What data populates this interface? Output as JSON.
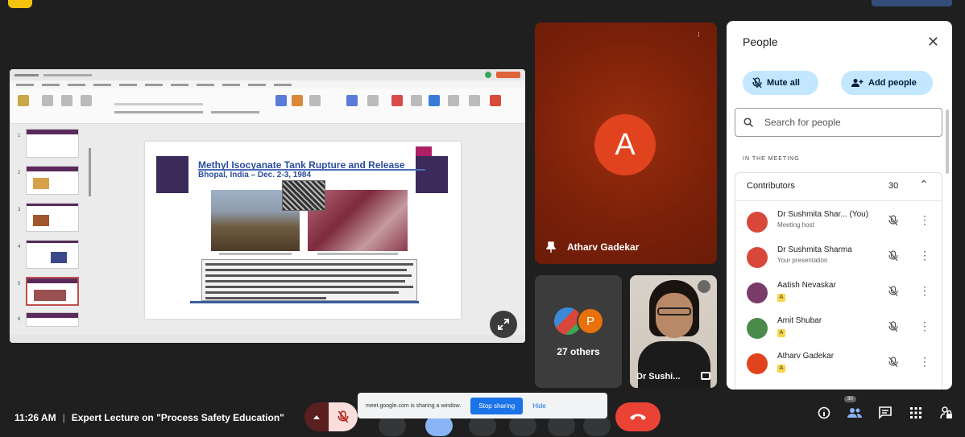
{
  "presentation": {
    "slide_title": "Methyl Isocyanate Tank Rupture and Release",
    "slide_subtitle": "Bhopal, India – Dec. 2-3, 1984"
  },
  "tiles": {
    "main_participant": {
      "initial": "A",
      "name": "Atharv Gadekar"
    },
    "others": {
      "initial": "P",
      "label": "27 others"
    },
    "self_view": {
      "name": "Dr Sushi..."
    }
  },
  "people_panel": {
    "title": "People",
    "mute_all_label": "Mute all",
    "add_people_label": "Add people",
    "search_placeholder": "Search for people",
    "section_label": "IN THE MEETING",
    "contributors_label": "Contributors",
    "contributors_count": "30",
    "people": [
      {
        "name": "Dr Sushmita Shar...",
        "suffix": "(You)",
        "sub": "Meeting host",
        "avatar_color": "#d9473b"
      },
      {
        "name": "Dr Sushmita Sharma",
        "sub": "Your presentation",
        "avatar_color": "#d9473b"
      },
      {
        "name": "Aatish Nevaskar",
        "badge": "A",
        "avatar_color": "#7a3b6b"
      },
      {
        "name": "Amit Shubar",
        "badge": "A",
        "avatar_color": "#4a8a4a"
      },
      {
        "name": "Atharv Gadekar",
        "badge": "A",
        "avatar_color": "#e0431e"
      }
    ]
  },
  "bottom_bar": {
    "time": "11:26 AM",
    "meeting_title": "Expert Lecture on \"Process Safety Education\"",
    "share_message": "meet.google.com is sharing a window.",
    "stop_sharing_label": "Stop sharing",
    "hide_label": "Hide",
    "people_count_badge": "30"
  },
  "colors": {
    "accent_blue": "#1a73e8",
    "end_call_red": "#ea4335",
    "pill_blue": "#c2e7ff",
    "tile_maroon": "#7a2009"
  }
}
